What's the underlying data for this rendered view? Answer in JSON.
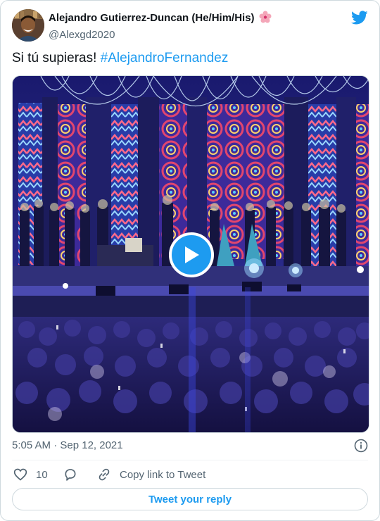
{
  "author": {
    "display_name": "Alejandro Gutierrez-Duncan (He/Him/His)",
    "handle": "@Alexgd2020",
    "avatar_icon": "profile-photo",
    "name_emoji_icon": "hibiscus-icon"
  },
  "tweet": {
    "text": "Si tú supieras! ",
    "hashtag": "#AlejandroFernandez",
    "timestamp": "5:05 AM · Sep 12, 2021"
  },
  "media": {
    "type": "video",
    "play_icon": "play-icon"
  },
  "actions": {
    "like_count": "10",
    "copy_link_label": "Copy link to Tweet",
    "reply_button_label": "Tweet your reply"
  },
  "colors": {
    "accent": "#1d9bf0",
    "text_primary": "#0f1419",
    "text_secondary": "#536471",
    "border": "#cfd9de"
  }
}
